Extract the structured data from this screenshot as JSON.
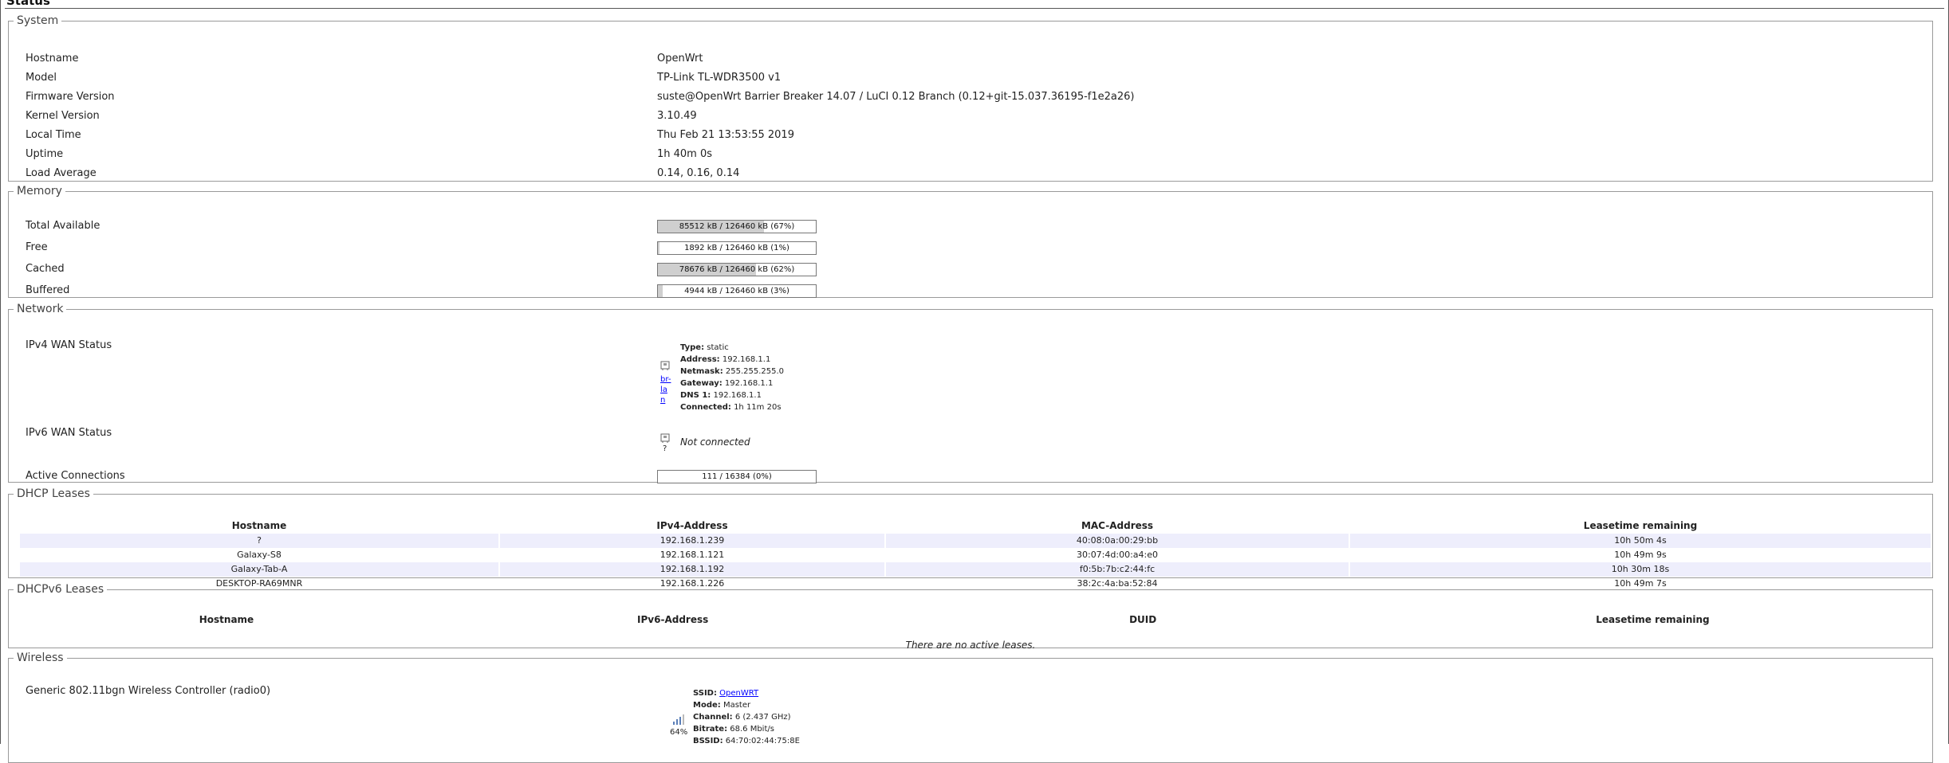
{
  "page": {
    "title": "Status"
  },
  "system": {
    "legend": "System",
    "rows": [
      {
        "label": "Hostname",
        "value": "OpenWrt"
      },
      {
        "label": "Model",
        "value": "TP-Link TL-WDR3500 v1"
      },
      {
        "label": "Firmware Version",
        "value": "suste@OpenWrt Barrier Breaker 14.07 / LuCI 0.12 Branch (0.12+git-15.037.36195-f1e2a26)"
      },
      {
        "label": "Kernel Version",
        "value": "3.10.49"
      },
      {
        "label": "Local Time",
        "value": "Thu Feb 21 13:53:55 2019"
      },
      {
        "label": "Uptime",
        "value": "1h 40m 0s"
      },
      {
        "label": "Load Average",
        "value": "0.14, 0.16, 0.14"
      }
    ]
  },
  "memory": {
    "legend": "Memory",
    "rows": [
      {
        "label": "Total Available",
        "text": "85512 kB / 126460 kB (67%)",
        "fraction": 0.67
      },
      {
        "label": "Free",
        "text": "1892 kB / 126460 kB (1%)",
        "fraction": 0.01
      },
      {
        "label": "Cached",
        "text": "78676 kB / 126460 kB (62%)",
        "fraction": 0.62
      },
      {
        "label": "Buffered",
        "text": "4944 kB / 126460 kB (3%)",
        "fraction": 0.03
      }
    ]
  },
  "network": {
    "legend": "Network",
    "ipv4_label": "IPv4 WAN Status",
    "ipv4_iface": "br-lan",
    "ipv4_iface_icon": "ethernet-port-icon",
    "ipv4_details": [
      {
        "k": "Type:",
        "v": " static"
      },
      {
        "k": "Address:",
        "v": " 192.168.1.1"
      },
      {
        "k": "Netmask:",
        "v": " 255.255.255.0"
      },
      {
        "k": "Gateway:",
        "v": " 192.168.1.1"
      },
      {
        "k": "DNS 1:",
        "v": " 192.168.1.1"
      },
      {
        "k": "Connected:",
        "v": " 1h 11m 20s"
      }
    ],
    "ipv6_label": "IPv6 WAN Status",
    "ipv6_iface": "?",
    "ipv6_icon": "ethernet-port-icon",
    "ipv6_status": "Not connected",
    "conn_label": "Active Connections",
    "conn_text": "111 / 16384 (0%)",
    "conn_fraction": 0.0
  },
  "dhcp": {
    "legend": "DHCP Leases",
    "headers": [
      "Hostname",
      "IPv4-Address",
      "MAC-Address",
      "Leasetime remaining"
    ],
    "rows": [
      [
        "?",
        "192.168.1.239",
        "40:08:0a:00:29:bb",
        "10h 50m 4s"
      ],
      [
        "Galaxy-S8",
        "192.168.1.121",
        "30:07:4d:00:a4:e0",
        "10h 49m 9s"
      ],
      [
        "Galaxy-Tab-A",
        "192.168.1.192",
        "f0:5b:7b:c2:44:fc",
        "10h 30m 18s"
      ],
      [
        "DESKTOP-RA69MNR",
        "192.168.1.226",
        "38:2c:4a:ba:52:84",
        "10h 49m 7s"
      ]
    ]
  },
  "dhcpv6": {
    "legend": "DHCPv6 Leases",
    "headers": [
      "Hostname",
      "IPv6-Address",
      "DUID",
      "Leasetime remaining"
    ],
    "empty": "There are no active leases."
  },
  "wireless": {
    "legend": "Wireless",
    "radio_label": "Generic 802.11bgn Wireless Controller (radio0)",
    "signal_icon": "signal-strength-icon",
    "signal": "64%",
    "details": [
      {
        "k": "SSID:",
        "v": "OpenWRT",
        "link": true
      },
      {
        "k": "Mode:",
        "v": " Master"
      },
      {
        "k": "Channel:",
        "v": " 6 (2.437 GHz)"
      },
      {
        "k": "Bitrate:",
        "v": " 68.6 Mbit/s"
      },
      {
        "k": "BSSID:",
        "v": " 64:70:02:44:75:8E"
      }
    ]
  }
}
